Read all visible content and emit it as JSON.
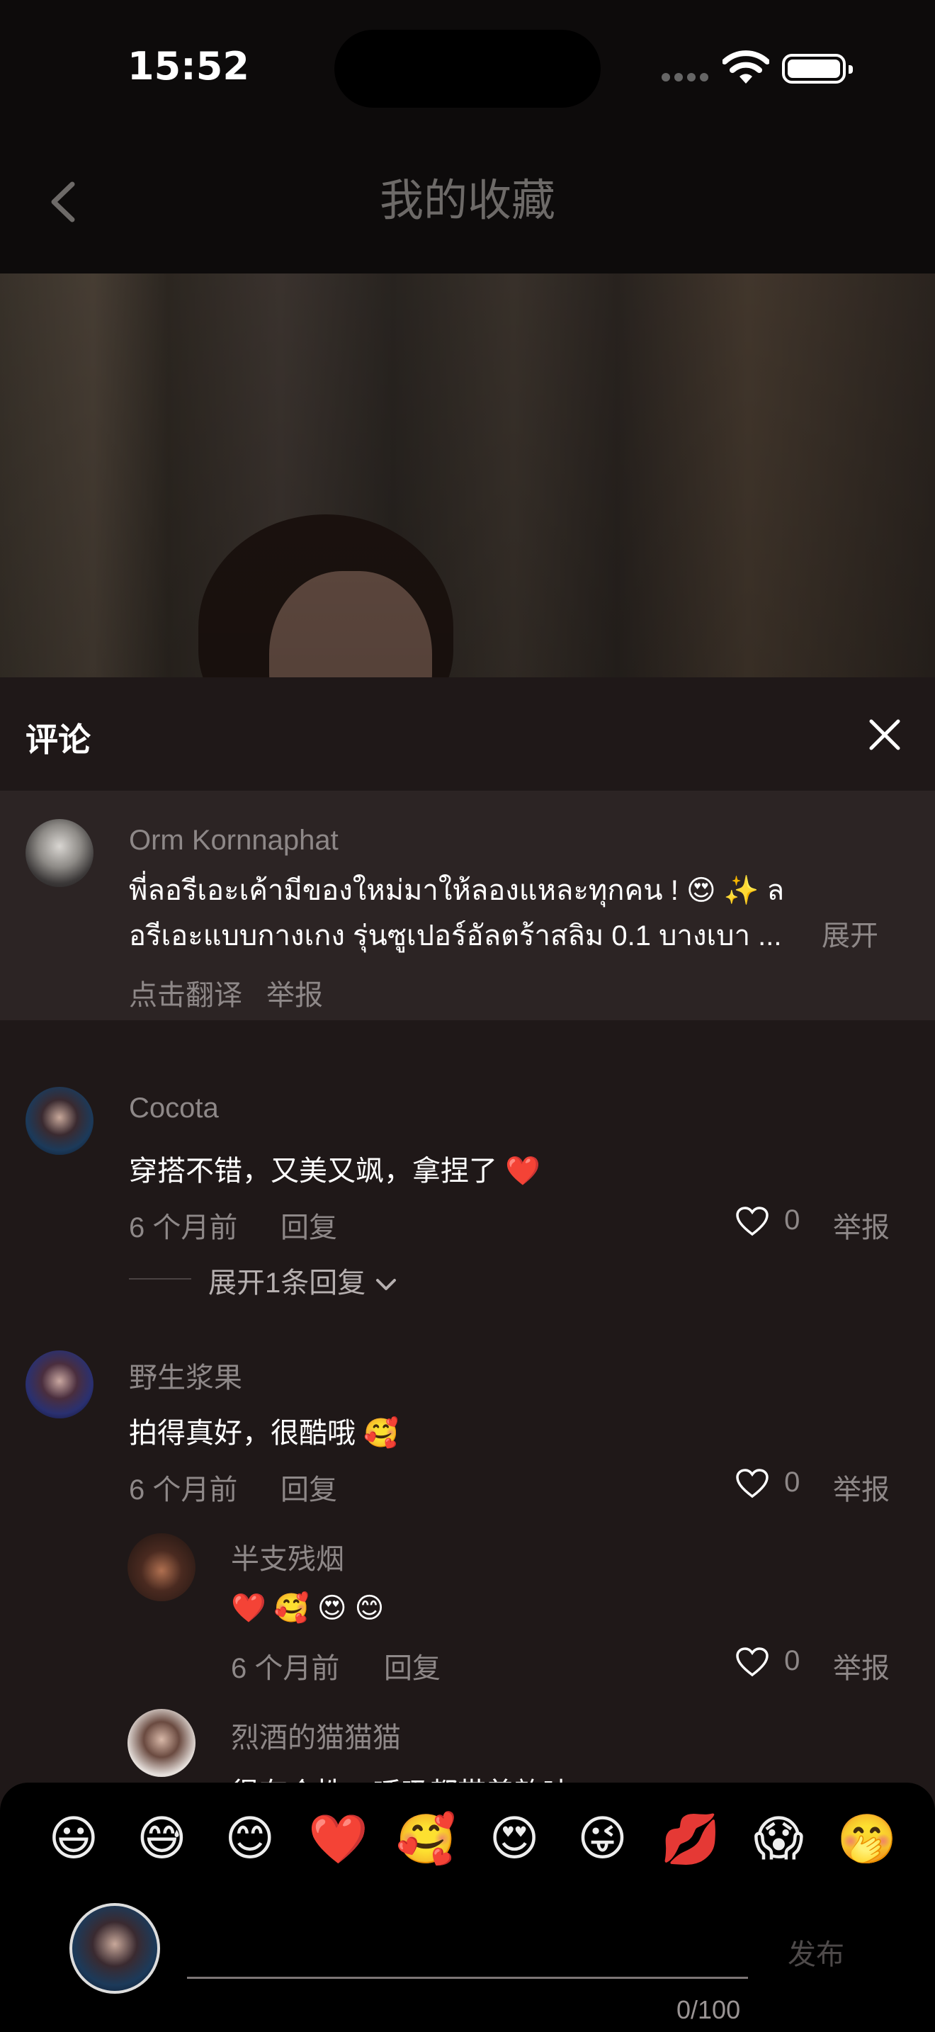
{
  "status_bar": {
    "time": "15:52"
  },
  "nav": {
    "title": "我的收藏"
  },
  "comments_panel": {
    "title": "评论"
  },
  "pinned_post": {
    "author": "Orm Kornnaphat",
    "text_line1": "พี่ลอรีเอะเค้ามีของใหม่มาให้ลองแหละทุกคน ! 😍 ✨ ล",
    "text_line2": "อรีเอะแบบกางเกง รุ่นซูเปอร์อัลตร้าสลิม 0.1 บางเบา ...",
    "expand_label": "展开",
    "translate_label": "点击翻译",
    "report_label": "举报"
  },
  "comments": [
    {
      "author": "Cocota",
      "text": "穿搭不错，又美又飒，拿捏了 ❤️",
      "time": "6 个月前",
      "reply_label": "回复",
      "likes": "0",
      "report_label": "举报",
      "expand_replies": "展开1条回复"
    },
    {
      "author": "野生浆果",
      "text": "拍得真好，很酷哦 🥰",
      "time": "6 个月前",
      "reply_label": "回复",
      "likes": "0",
      "report_label": "举报",
      "replies": [
        {
          "author": "半支残烟",
          "text": "❤️ 🥰 😍 😊",
          "time": "6 个月前",
          "reply_label": "回复",
          "likes": "0",
          "report_label": "举报"
        },
        {
          "author": "烈酒的猫猫猫",
          "text": "很有个性，呼吸都带着韵味"
        }
      ]
    }
  ],
  "composer": {
    "emojis": [
      "😃",
      "😅",
      "😊",
      "❤️",
      "🥰",
      "😍",
      "😜",
      "💋",
      "😱",
      "🤭"
    ],
    "send_label": "发布",
    "counter": "0/100"
  }
}
